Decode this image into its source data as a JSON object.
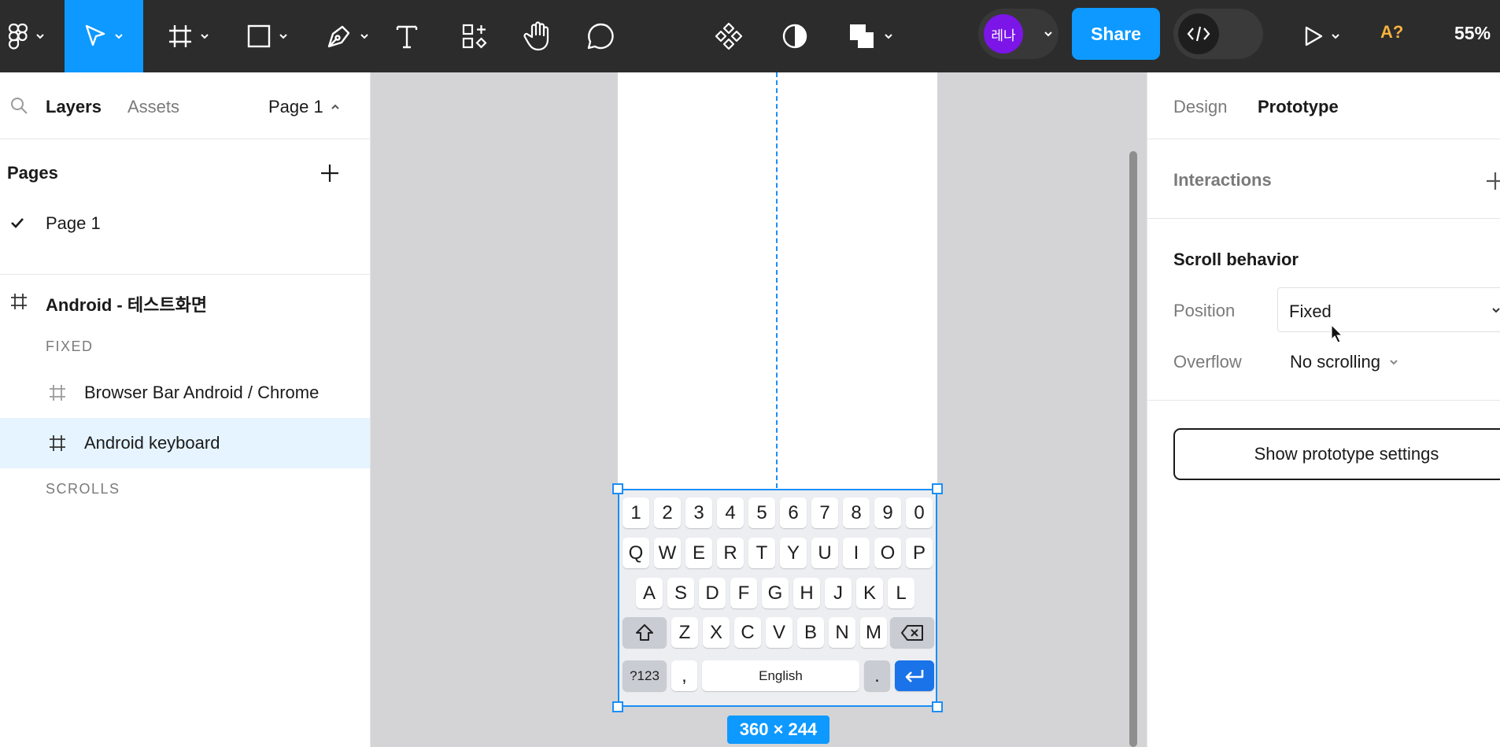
{
  "toolbar": {
    "share_label": "Share",
    "avatar_initials": "레나",
    "a11y_label": "A?",
    "zoom_label": "55%",
    "colors": {
      "bg": "#2c2c2c",
      "accent": "#0d99ff",
      "avatar": "#7b15e8"
    }
  },
  "left_panel": {
    "tabs": {
      "layers": "Layers",
      "assets": "Assets"
    },
    "current_page": "Page 1",
    "pages_header": "Pages",
    "pages": [
      "Page 1"
    ],
    "root_frame": "Android - 테스트화면",
    "fixed_section": "FIXED",
    "layers": [
      "Browser Bar Android / Chrome",
      "Android keyboard"
    ],
    "scrolls_section": "SCROLLS"
  },
  "canvas": {
    "keyboard": {
      "row1": [
        "1",
        "2",
        "3",
        "4",
        "5",
        "6",
        "7",
        "8",
        "9",
        "0"
      ],
      "row2": [
        "Q",
        "W",
        "E",
        "R",
        "T",
        "Y",
        "U",
        "I",
        "O",
        "P"
      ],
      "row3": [
        "A",
        "S",
        "D",
        "F",
        "G",
        "H",
        "J",
        "K",
        "L"
      ],
      "row4": [
        "Z",
        "X",
        "C",
        "V",
        "B",
        "N",
        "M"
      ],
      "symbols_key": "?123",
      "comma_key": ",",
      "space_key": "English",
      "period_key": "."
    },
    "size_label": "360 × 244"
  },
  "right_panel": {
    "tabs": {
      "design": "Design",
      "prototype": "Prototype"
    },
    "interactions_header": "Interactions",
    "scroll_behavior_header": "Scroll behavior",
    "position_label": "Position",
    "position_value": "Fixed",
    "overflow_label": "Overflow",
    "overflow_value": "No scrolling",
    "prototype_settings_button": "Show prototype settings"
  }
}
